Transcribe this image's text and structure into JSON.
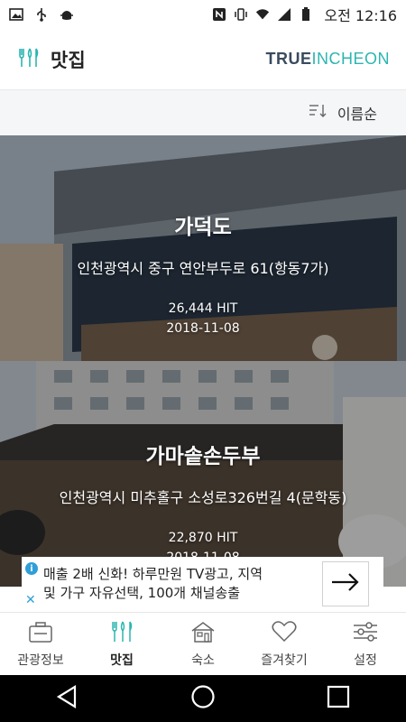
{
  "status_bar": {
    "time": "오전 12:16"
  },
  "header": {
    "title": "맛집",
    "brand_part1": "TRUE",
    "brand_part2": "INCHEON"
  },
  "sort": {
    "label": "이름순"
  },
  "cards": [
    {
      "name": "가덕도",
      "address": "인천광역시 중구 연안부두로 61(항동7가)",
      "hits": "26,444 HIT",
      "date": "2018-11-08"
    },
    {
      "name": "가마솥손두부",
      "address": "인천광역시 미추홀구 소성로326번길 4(문학동)",
      "hits": "22,870 HIT",
      "date": "2018-11-08"
    }
  ],
  "ad": {
    "line1": "매출 2배 신화! 하루만원 TV광고, 지역",
    "line2": "및 가구 자유선택, 100개 채널송출"
  },
  "bottom_nav": [
    {
      "label": "관광정보",
      "icon": "briefcase-icon"
    },
    {
      "label": "맛집",
      "icon": "fork-knife-icon"
    },
    {
      "label": "숙소",
      "icon": "house-icon"
    },
    {
      "label": "즐겨찾기",
      "icon": "heart-icon"
    },
    {
      "label": "설정",
      "icon": "sliders-icon"
    }
  ],
  "colors": {
    "accent": "#2bb6b0",
    "brand_dark": "#3a4b5e"
  }
}
